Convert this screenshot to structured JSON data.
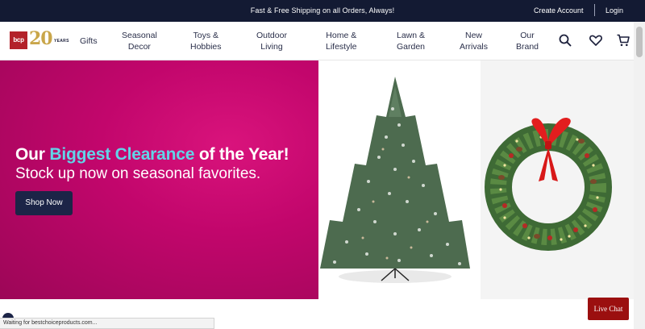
{
  "topbar": {
    "promo": "Fast & Free Shipping on all Orders, Always!",
    "create_account": "Create Account",
    "login": "Login"
  },
  "logo": {
    "text": "bcp",
    "number": "20",
    "years": "YEARS"
  },
  "nav": [
    {
      "line1": "Gifts",
      "line2": ""
    },
    {
      "line1": "Seasonal",
      "line2": "Decor"
    },
    {
      "line1": "Toys &",
      "line2": "Hobbies"
    },
    {
      "line1": "Outdoor",
      "line2": "Living"
    },
    {
      "line1": "Home &",
      "line2": "Lifestyle"
    },
    {
      "line1": "Lawn &",
      "line2": "Garden"
    },
    {
      "line1": "New",
      "line2": "Arrivals"
    },
    {
      "line1": "Our",
      "line2": "Brand"
    }
  ],
  "icons": {
    "search": "search-icon",
    "wishlist": "heart-icon",
    "cart": "cart-icon"
  },
  "hero": {
    "headline_pre": "Our ",
    "headline_highlight": "Biggest Clearance",
    "headline_post": " of the Year!",
    "subheadline": "Stock up now on seasonal favorites.",
    "cta": "Shop Now"
  },
  "status": {
    "text": "Waiting for bestchoiceproducts.com..."
  },
  "chat": {
    "label": "Live Chat"
  },
  "colors": {
    "topbar": "#131a33",
    "hero": "#c2066c",
    "highlight": "#62d4e8",
    "cta": "#1c2447",
    "chat": "#9b0f0f"
  }
}
